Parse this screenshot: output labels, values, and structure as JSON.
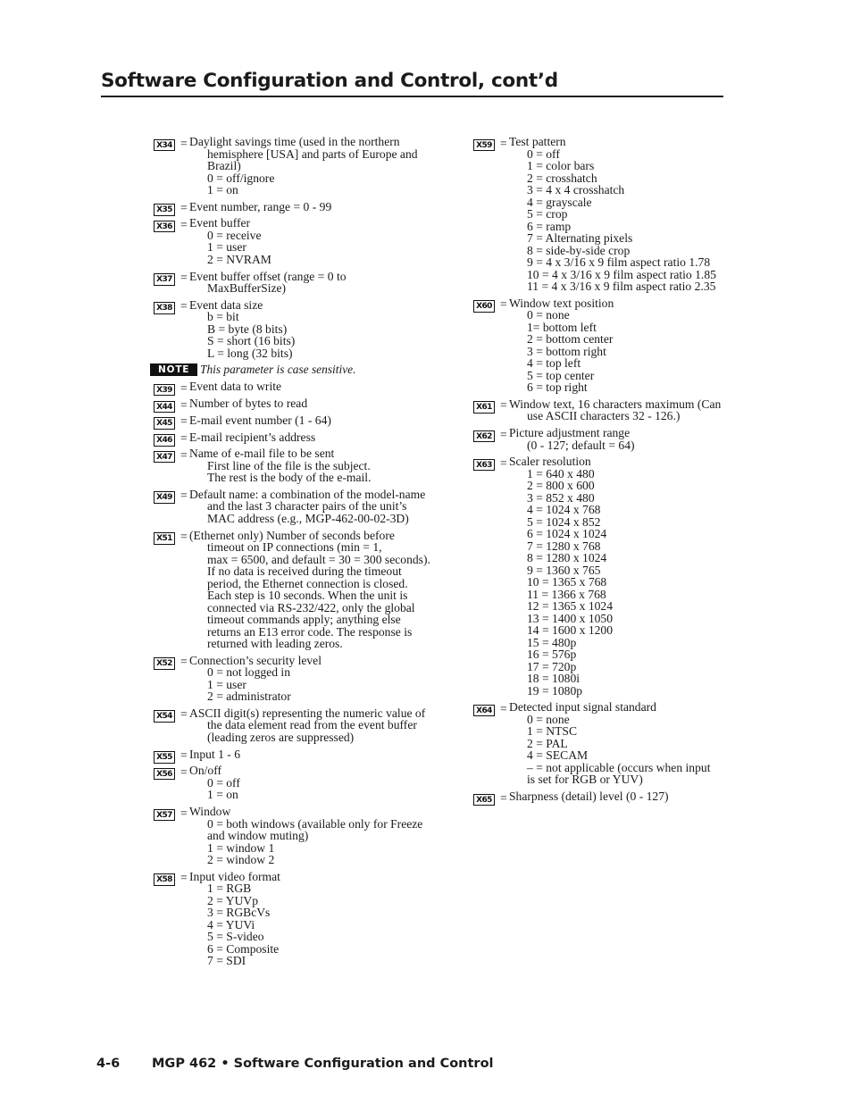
{
  "header": {
    "title": "Software Configuration and Control, cont’d"
  },
  "footer": {
    "page_number": "4-6",
    "title": "MGP 462 • Software Configuration and Control"
  },
  "note": {
    "badge": "NOTE",
    "text": "This parameter is case sensitive."
  },
  "equals": "=",
  "left_column": [
    {
      "badge": "X34",
      "desc": "Daylight savings time (used in the northern",
      "cont": [
        "hemisphere [USA] and parts of Europe and",
        "Brazil)"
      ],
      "options": [
        "0 = off/ignore",
        "1 = on"
      ]
    },
    {
      "badge": "X35",
      "desc": "Event number, range = 0 - 99",
      "cont": [],
      "options": []
    },
    {
      "badge": "X36",
      "desc": "Event buffer",
      "cont": [],
      "options": [
        "0 = receive",
        "1 = user",
        "2 = NVRAM"
      ]
    },
    {
      "badge": "X37",
      "desc": "Event buffer offset (range = 0 to",
      "cont": [
        "MaxBufferSize)"
      ],
      "options": []
    },
    {
      "badge": "X38",
      "desc": "Event data size",
      "cont": [],
      "options": [
        "b = bit",
        "B = byte (8 bits)",
        "S = short (16 bits)",
        "L = long (32 bits)"
      ]
    },
    {
      "badge": "X39",
      "desc": "Event data to write",
      "cont": [],
      "options": []
    },
    {
      "badge": "X44",
      "desc": "Number of bytes to read",
      "cont": [],
      "options": []
    },
    {
      "badge": "X45",
      "desc": "E-mail event number (1 - 64)",
      "cont": [],
      "options": []
    },
    {
      "badge": "X46",
      "desc": "E-mail recipient’s address",
      "cont": [],
      "options": []
    },
    {
      "badge": "X47",
      "desc": "Name of e-mail file to be sent",
      "cont": [],
      "options": [
        "First line of the file is the subject.",
        "The rest is the body of the e-mail."
      ]
    },
    {
      "badge": "X49",
      "desc": "Default name: a combination of the model-name",
      "cont": [
        "and the last 3 character pairs of the  unit’s",
        "MAC address (e.g., MGP-462-00-02-3D)"
      ],
      "options": []
    },
    {
      "badge": "X51",
      "desc": "(Ethernet only)  Number of seconds before",
      "cont": [
        "timeout on IP connections (min = 1,",
        "max = 6500, and default = 30 = 300 seconds).",
        "If no data is received during the timeout",
        "period, the Ethernet connection is closed.",
        "Each step is 10 seconds.  When the unit is",
        "connected via RS-232/422, only the global",
        "timeout commands apply; anything else",
        "returns an E13 error code.  The response is",
        "returned with leading zeros."
      ],
      "options": []
    },
    {
      "badge": "X52",
      "desc": "Connection’s security level",
      "cont": [],
      "options": [
        "0 = not logged in",
        "1 = user",
        "2 = administrator"
      ]
    },
    {
      "badge": "X54",
      "desc": "ASCII digit(s) representing the numeric value of",
      "cont": [
        "the data element read from the event buffer",
        "(leading zeros are suppressed)"
      ],
      "options": []
    },
    {
      "badge": "X55",
      "desc": "Input 1 - 6",
      "cont": [],
      "options": []
    },
    {
      "badge": "X56",
      "desc": "On/off",
      "cont": [],
      "options": [
        "0 = off",
        "1 = on"
      ]
    },
    {
      "badge": "X57",
      "desc": "Window",
      "cont": [],
      "options": [
        "0 = both windows (available only for Freeze",
        "and window muting)",
        "1 = window 1",
        "2 = window 2"
      ]
    },
    {
      "badge": "X58",
      "desc": "Input video format",
      "cont": [],
      "options": [
        "1 = RGB",
        "2 = YUVp",
        "3 = RGBcVs",
        "4 = YUVi",
        "5 = S-video",
        "6 = Composite",
        "7 = SDI"
      ]
    }
  ],
  "right_column": [
    {
      "badge": "X59",
      "desc": "Test pattern",
      "cont": [],
      "options": [
        "0 = off",
        "1 = color bars",
        "2 = crosshatch",
        "3 = 4 x 4 crosshatch",
        "4 = grayscale",
        "5 = crop",
        "6 = ramp",
        "7 = Alternating pixels",
        "8 = side-by-side crop",
        "9 = 4 x 3/16 x 9 film aspect ratio 1.78",
        "10 = 4 x 3/16 x 9 film aspect ratio 1.85",
        "11 = 4 x 3/16 x 9 film aspect ratio 2.35"
      ]
    },
    {
      "badge": "X60",
      "desc": "Window text position",
      "cont": [],
      "options": [
        "0 = none",
        "1= bottom left",
        "2 = bottom center",
        "3 = bottom right",
        "4 = top left",
        "5 = top center",
        "6 = top right"
      ]
    },
    {
      "badge": "X61",
      "desc": "Window text, 16 characters maximum (Can",
      "cont": [
        "use ASCII characters 32 - 126.)"
      ],
      "options": []
    },
    {
      "badge": "X62",
      "desc": "Picture adjustment range",
      "cont": [],
      "options": [
        "(0 - 127; default = 64)"
      ]
    },
    {
      "badge": "X63",
      "desc": "Scaler resolution",
      "cont": [],
      "options": [
        "1 = 640 x 480",
        "2 = 800 x 600",
        "3 = 852 x 480",
        "4 = 1024 x 768",
        "5 = 1024 x 852",
        "6 = 1024 x 1024",
        "7 = 1280 x 768",
        "8 = 1280 x 1024",
        "9 = 1360 x 765",
        "10 = 1365 x 768",
        "11 = 1366 x 768",
        "12 = 1365 x 1024",
        "13 = 1400 x 1050",
        "14 = 1600 x 1200",
        "15 = 480p",
        "16 = 576p",
        "17 = 720p",
        "18 = 1080i",
        "19 = 1080p"
      ]
    },
    {
      "badge": "X64",
      "desc": "Detected input signal standard",
      "cont": [],
      "options": [
        "0 = none",
        "1 = NTSC",
        "2 = PAL",
        "4 = SECAM",
        "–  = not applicable (occurs when input",
        "   is set for RGB or YUV)"
      ]
    },
    {
      "badge": "X65",
      "desc": "Sharpness (detail) level (0 - 127)",
      "cont": [],
      "options": []
    }
  ]
}
